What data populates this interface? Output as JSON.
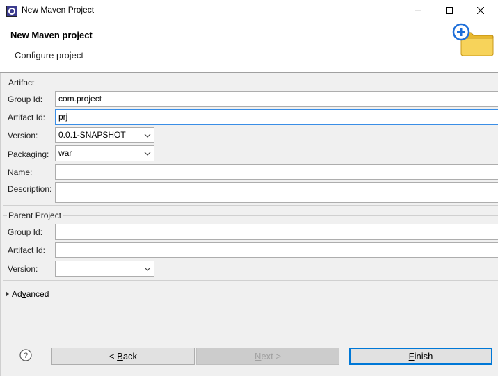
{
  "window": {
    "title": "New Maven Project",
    "minimize_icon": "minimize-icon",
    "maximize_icon": "maximize-icon",
    "close_icon": "close-icon"
  },
  "header": {
    "title": "New Maven project",
    "subtitle": "Configure project",
    "banner_icon": "new-folder-icon"
  },
  "artifact": {
    "group_title": "Artifact",
    "group_id_label": "Group Id:",
    "group_id_value": "com.project",
    "artifact_id_label": "Artifact Id:",
    "artifact_id_value": "prj",
    "version_label": "Version:",
    "version_value": "0.0.1-SNAPSHOT",
    "packaging_label": "Packaging:",
    "packaging_value": "war",
    "name_label": "Name:",
    "name_value": "",
    "description_label": "Description:",
    "description_value": ""
  },
  "parent": {
    "group_title": "Parent Project",
    "group_id_label": "Group Id:",
    "group_id_value": "",
    "artifact_id_label": "Artifact Id:",
    "artifact_id_value": "",
    "version_label": "Version:",
    "version_value": ""
  },
  "advanced": {
    "label_prefix": "Ad",
    "label_mnemonic": "v",
    "label_suffix": "anced"
  },
  "buttons": {
    "back_prefix": "< ",
    "back_mnemonic": "B",
    "back_suffix": "ack",
    "next_mnemonic": "N",
    "next_suffix": "ext >",
    "finish_mnemonic": "F",
    "finish_suffix": "inish",
    "help_icon": "help-icon"
  },
  "colors": {
    "focus_border": "#3a8ee6",
    "default_button_border": "#0078d7",
    "panel_background": "#f0f0f0"
  }
}
